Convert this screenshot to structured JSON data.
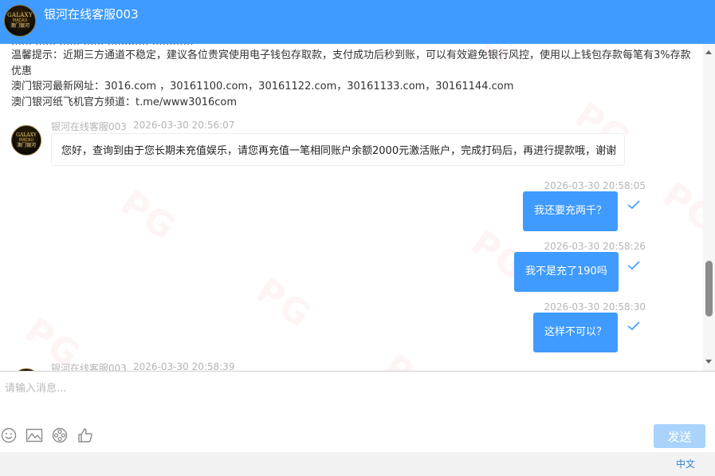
{
  "header": {
    "title": "银河在线客服003",
    "logo_lines": [
      "GALAXY",
      "MACAU",
      "澳门银河"
    ]
  },
  "system_message": {
    "cut_line": "…… …… …… ……  …………  …………",
    "lines": [
      "温馨提示：近期三方通道不稳定，建议各位贵宾使用电子钱包存取款，支付成功后秒到账，可以有效避免银行风控，使用以上钱包存款每笔有3%存款优惠",
      "澳门银河最新网址：3016.com ，30161100.com，30161122.com，30161133.com，30161144.com",
      "澳门银河纸飞机官方频道：t.me/www3016com"
    ]
  },
  "messages": [
    {
      "sender": "银河在线客服003",
      "time": "2026-03-30 20:56:07",
      "text": "您好，查询到由于您长期未充值娱乐，请您再充值一笔相同账户余额2000元激活账户，完成打码后，再进行提款哦，谢谢"
    },
    {
      "time": "2026-03-30 20:58:05",
      "text": "我还要充两千？"
    },
    {
      "time": "2026-03-30 20:58:26",
      "text": "我不是充了190吗"
    },
    {
      "time": "2026-03-30 20:58:30",
      "text": "这样不可以？"
    },
    {
      "sender": "银河在线客服003",
      "time": "2026-03-30 20:58:39"
    }
  ],
  "watermark": "PG",
  "input": {
    "placeholder": "请输入消息..."
  },
  "toolbar": {
    "icons": [
      "emoji-icon",
      "image-icon",
      "video-icon",
      "thumbs-up-icon"
    ],
    "send_label": "发送"
  },
  "footer": {
    "language": "中文"
  },
  "colors": {
    "brand": "#3f9bff",
    "send_disabled": "#a9d3fb",
    "lang_link": "#2f86d6"
  }
}
